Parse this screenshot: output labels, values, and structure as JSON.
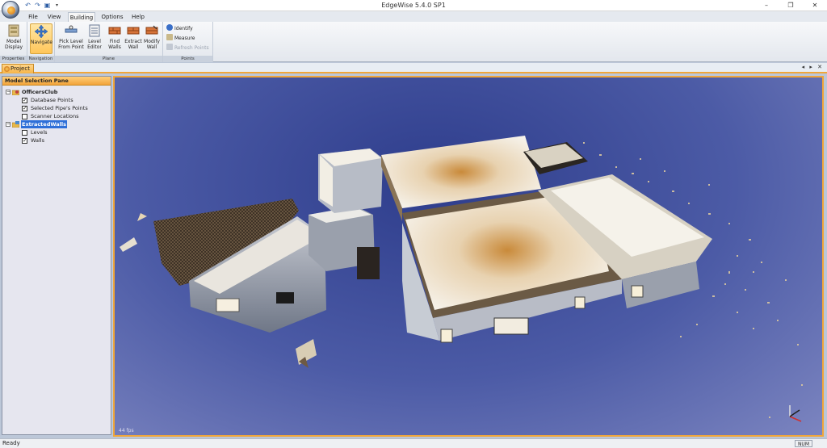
{
  "window": {
    "title": "EdgeWise 5.4.0 SP1",
    "controls": [
      "–",
      "❐",
      "✕"
    ]
  },
  "qat": {
    "icons": [
      "undo-icon",
      "redo-icon",
      "save-icon",
      "customize-dropdown-icon"
    ]
  },
  "tabs": [
    "File",
    "View",
    "Building",
    "Options",
    "Help"
  ],
  "active_tab": "Building",
  "ribbon": {
    "groups": {
      "properties": "Properties",
      "navigation": "Navigation",
      "plane": "Plane",
      "points": "Points"
    },
    "buttons": {
      "model_display": [
        "Model",
        "Display"
      ],
      "navigate": [
        "Navigate"
      ],
      "pick_level": [
        "Pick Level",
        "From Point"
      ],
      "level_editor": [
        "Level",
        "Editor"
      ],
      "find_walls": [
        "Find",
        "Walls"
      ],
      "extract_wall": [
        "Extract",
        "Wall"
      ],
      "modify_wall": [
        "Modify",
        "Wall"
      ]
    },
    "points_buttons": {
      "identify": "Identify",
      "measure": "Measure",
      "refresh_points": "Refresh Points"
    }
  },
  "document_tab": "Project",
  "strip_controls": "◂ ▸ ✕",
  "pane": {
    "title": "Model Selection Pane",
    "tree": [
      {
        "label": "OfficersClub",
        "type": "root"
      },
      {
        "label": "Database Points",
        "checked": true
      },
      {
        "label": "Selected Pipe's Points",
        "checked": true
      },
      {
        "label": "Scanner Locations",
        "checked": false
      },
      {
        "label": "ExtractedWalls",
        "type": "root",
        "selected": true
      },
      {
        "label": "Levels",
        "checked": false
      },
      {
        "label": "Walls",
        "checked": true
      }
    ]
  },
  "viewport": {
    "fps": "44 fps"
  },
  "status": {
    "left": "Ready",
    "num": "NUM"
  },
  "colors": {
    "accent": "#f0a63a",
    "selection": "#2e6fd8",
    "viewport_bg": "#4c5ba6"
  }
}
